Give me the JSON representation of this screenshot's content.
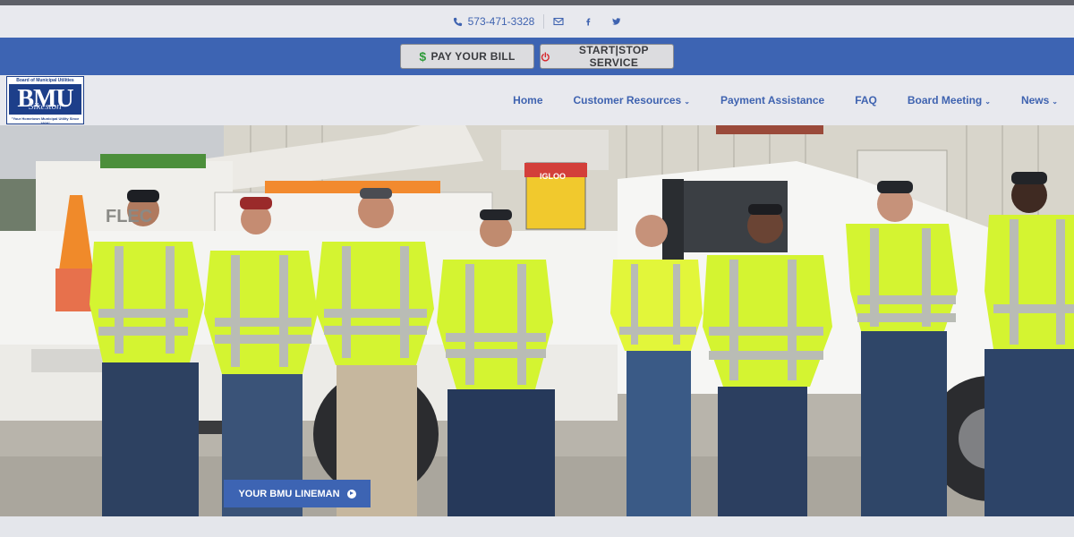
{
  "topbar": {
    "phone": "573-471-3328",
    "phone_icon": "phone-icon",
    "email_icon": "envelope-icon",
    "facebook_icon": "facebook-icon",
    "twitter_icon": "twitter-icon"
  },
  "service": {
    "pay_label": "PAY YOUR BILL",
    "pay_icon": "$",
    "start_label": "START|STOP SERVICE",
    "start_icon": "power-icon"
  },
  "logo": {
    "line1": "Board of Municipal Utilities",
    "main": "BMU",
    "script": "Sikeston",
    "tagline": "\"Your Hometown Municipal Utility Since 1920\""
  },
  "nav": {
    "items": [
      {
        "label": "Home",
        "dropdown": false
      },
      {
        "label": "Customer Resources",
        "dropdown": true
      },
      {
        "label": "Payment Assistance",
        "dropdown": false
      },
      {
        "label": "FAQ",
        "dropdown": false
      },
      {
        "label": "Board Meeting",
        "dropdown": true
      },
      {
        "label": "News",
        "dropdown": true
      }
    ]
  },
  "hero": {
    "button_label": "YOUR BMU LINEMAN",
    "truck_text": "FLEC",
    "cooler_text": "IGLOO"
  },
  "colors": {
    "brand_blue": "#3d64b3",
    "nav_bg": "#e8e9ee",
    "vest": "#d4f431",
    "stripe": "#b9bcb5"
  }
}
